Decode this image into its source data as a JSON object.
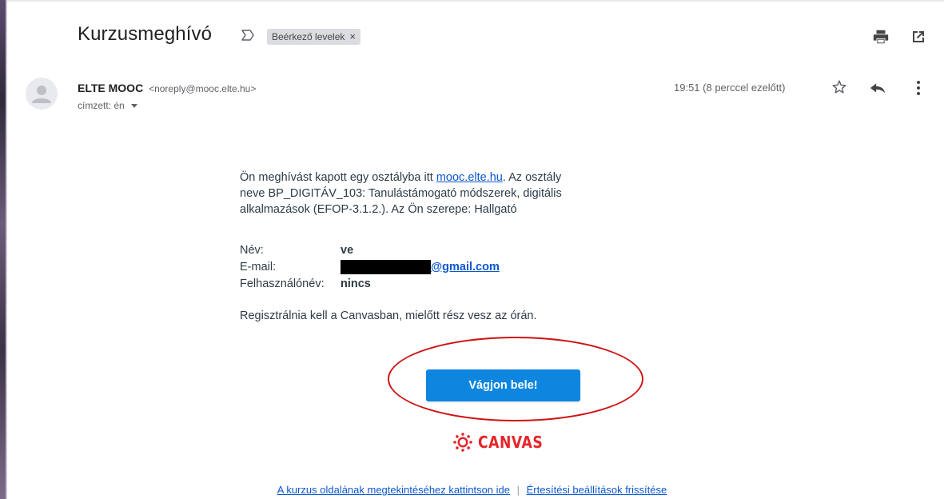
{
  "email": {
    "subject": "Kurzusmeghívó",
    "label": "Beérkező levelek",
    "label_close": "×",
    "sender_name": "ELTE MOOC",
    "sender_email": "<noreply@mooc.elte.hu>",
    "recipient": "címzett: én",
    "timestamp": "19:51 (8 perccel ezelőtt)"
  },
  "body": {
    "intro_1": "Ön meghívást kapott egy osztályba itt ",
    "intro_link": "mooc.elte.hu",
    "intro_2": ". Az osztály neve BP_DIGITÁV_103: Tanulástámogató módszerek, digitális alkalmazások (EFOP-3.1.2.). Az Ön szerepe: Hallgató",
    "fields": [
      {
        "key": "Név:",
        "value": "ve"
      },
      {
        "key": "E-mail:",
        "value": "@gmail.com"
      },
      {
        "key": "Felhasználónév:",
        "value": "nincs"
      }
    ],
    "register_text": "Regisztrálnia kell a Canvasban, mielőtt rész vesz az órán.",
    "cta_label": "Vágjon bele!",
    "logo_text": "CANVAS",
    "footer_link_1": "A kurzus oldalának megtekintéséhez kattintson ide",
    "footer_sep": "|",
    "footer_link_2": "Értesítési beállítások frissítése"
  },
  "icons": {
    "important": "important-marker-icon",
    "print": "print-icon",
    "popout": "open-in-new-window-icon",
    "star": "star-icon",
    "reply": "reply-icon",
    "more": "more-vertical-icon",
    "avatar": "default-avatar-icon",
    "canvas": "canvas-logo-icon"
  },
  "colors": {
    "cta": "#0e86e0",
    "annotation": "#cf1212",
    "canvas_red": "#e72429",
    "link": "#0b57d0"
  }
}
